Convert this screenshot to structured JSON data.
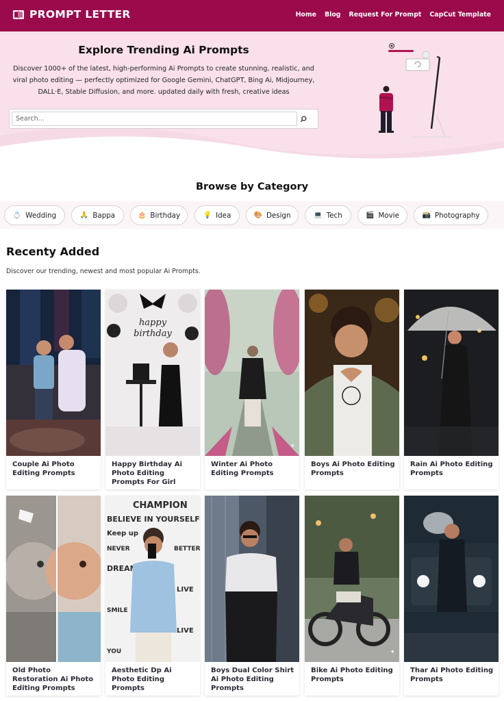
{
  "header": {
    "logo_text": "PROMPT LETTER",
    "nav": [
      "Home",
      "Blog",
      "Request For Prompt",
      "CapCut Template"
    ]
  },
  "hero": {
    "title": "Explore Trending Ai Prompts",
    "description": "Discover 1000+ of the latest, high-performing Ai Prompts to create stunning, realistic, and viral photo editing — perfectly optimized for Google Gemini, ChatGPT, Bing Ai, Midjourney, DALL·E, Stable Diffusion, and more. updated daily with fresh, creative ideas",
    "search_placeholder": "Search..."
  },
  "browse": {
    "title": "Browse by Category",
    "categories": [
      {
        "label": "Wedding",
        "emoji": "💍"
      },
      {
        "label": "Bappa",
        "emoji": "🙏"
      },
      {
        "label": "Birthday",
        "emoji": "🎂"
      },
      {
        "label": "Idea",
        "emoji": "💡"
      },
      {
        "label": "Design",
        "emoji": "🎨"
      },
      {
        "label": "Tech",
        "emoji": "💻"
      },
      {
        "label": "Movie",
        "emoji": "🎬"
      },
      {
        "label": "Photography",
        "emoji": "📸"
      }
    ]
  },
  "recent": {
    "title": "Recenty Added",
    "subtitle": "Discover our trending, newest and most popular Ai Prompts.",
    "cards": [
      {
        "title": "Couple Ai Photo Editing Prompts"
      },
      {
        "title": "Happy Birthday Ai Photo Editing Prompts For Girl"
      },
      {
        "title": "Winter Ai Photo Editing Prompts"
      },
      {
        "title": "Boys Ai Photo Editing Prompts"
      },
      {
        "title": "Rain Ai Photo Editing Prompts"
      },
      {
        "title": "Old Photo Restoration Ai Photo Editing Prompts"
      },
      {
        "title": "Aesthetic Dp Ai Photo Editing Prompts"
      },
      {
        "title": "Boys Dual Color Shirt Ai Photo Editing Prompts"
      },
      {
        "title": "Bike Ai Photo Editing Prompts"
      },
      {
        "title": "Thar Ai Photo Editing Prompts"
      }
    ]
  },
  "colors": {
    "brand": "#9b0b4c",
    "hero_bg": "#f9e0ea"
  }
}
